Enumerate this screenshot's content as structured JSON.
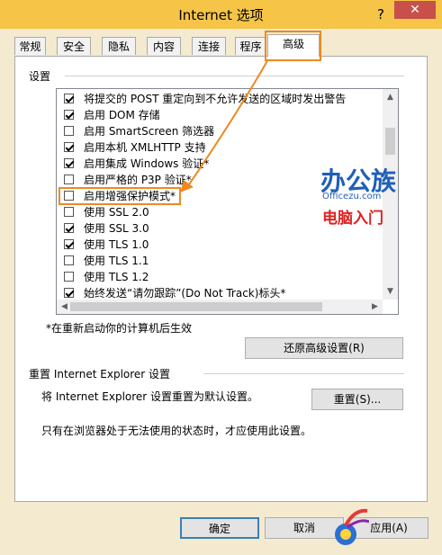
{
  "window": {
    "title": "Internet 选项",
    "help_glyph": "?",
    "close_glyph": "✕"
  },
  "tabs": [
    {
      "label": "常规"
    },
    {
      "label": "安全"
    },
    {
      "label": "隐私"
    },
    {
      "label": "内容"
    },
    {
      "label": "连接"
    },
    {
      "label": "程序"
    },
    {
      "label": "高级",
      "active": true
    }
  ],
  "settings": {
    "group_label": "设置",
    "items": [
      {
        "label": "将提交的 POST 重定向到不允许发送的区域时发出警告",
        "checked": true
      },
      {
        "label": "启用 DOM 存储",
        "checked": true
      },
      {
        "label": "启用 SmartScreen 筛选器",
        "checked": false
      },
      {
        "label": "启用本机 XMLHTTP 支持",
        "checked": true
      },
      {
        "label": "启用集成 Windows 验证*",
        "checked": true
      },
      {
        "label": "启用严格的 P3P 验证*",
        "checked": false
      },
      {
        "label": "启用增强保护模式*",
        "checked": false,
        "highlighted": true
      },
      {
        "label": "使用 SSL 2.0",
        "checked": false
      },
      {
        "label": "使用 SSL 3.0",
        "checked": true
      },
      {
        "label": "使用 TLS 1.0",
        "checked": true
      },
      {
        "label": "使用 TLS 1.1",
        "checked": false
      },
      {
        "label": "使用 TLS 1.2",
        "checked": false
      },
      {
        "label": "始终发送“请勿跟踪”(Do Not Track)标头*",
        "checked": true
      }
    ],
    "restart_note": "*在重新启动你的计算机后生效",
    "restore_button": "还原高级设置(R)"
  },
  "reset": {
    "group_label": "重置 Internet Explorer 设置",
    "description": "将 Internet Explorer 设置重置为默认设置。",
    "button": "重置(S)...",
    "warning": "只有在浏览器处于无法使用的状态时，才应使用此设置。"
  },
  "footer": {
    "ok": "确定",
    "cancel": "取消",
    "apply": "应用(A)"
  },
  "watermark": {
    "brand": "办公族",
    "url": "Officezu.com",
    "tagline": "电脑入门"
  },
  "colors": {
    "titlebar": "#f6c447",
    "close": "#c7504b",
    "highlight": "#ec8a22"
  }
}
